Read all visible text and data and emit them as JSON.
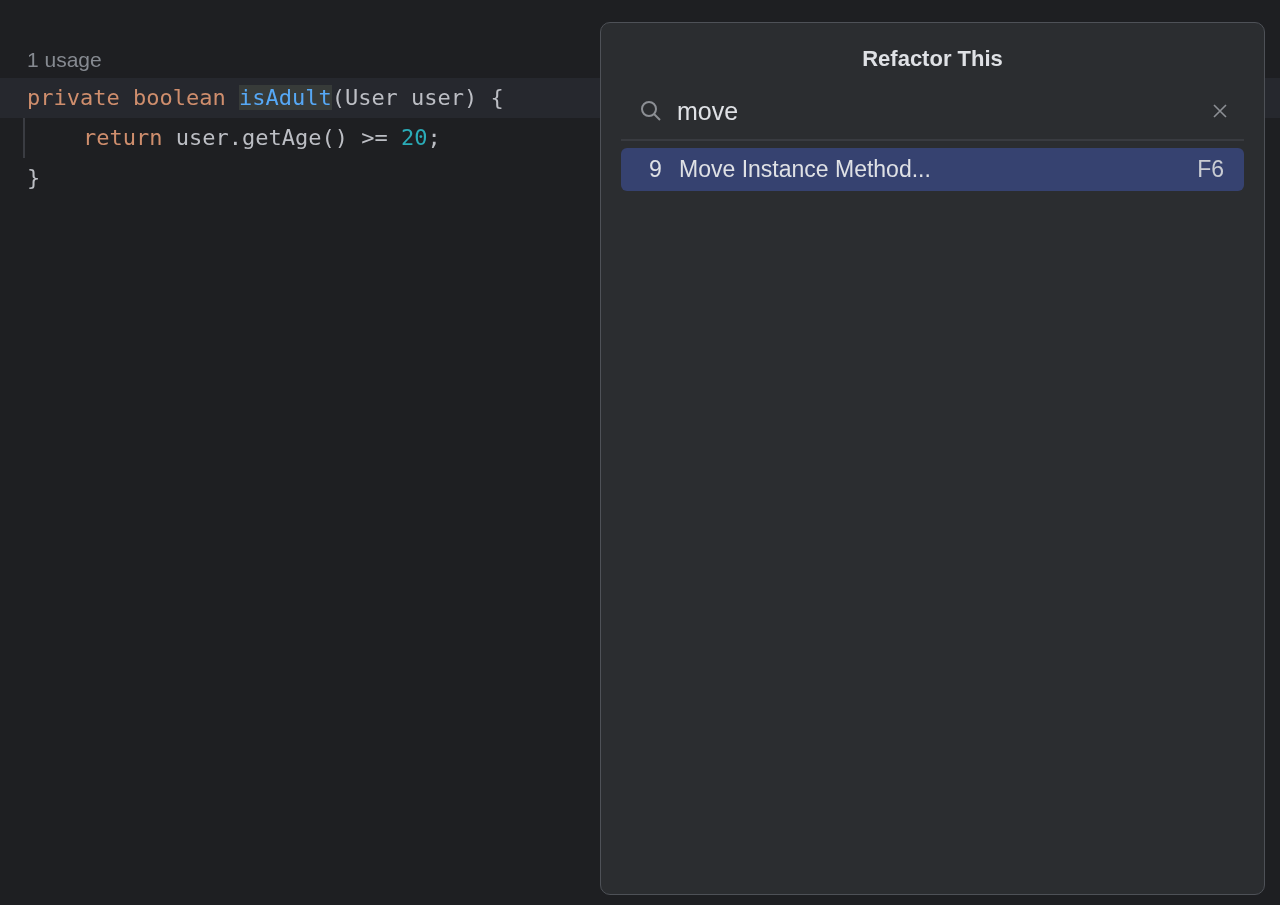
{
  "editor": {
    "inlay_hint": "1 usage",
    "lines": [
      {
        "current": true,
        "tokens": [
          {
            "kind": "keyword",
            "text": "private boolean ",
            "highlighted": false
          },
          {
            "kind": "method",
            "text": "isAdult",
            "highlighted": true
          },
          {
            "kind": "plain",
            "text": "(User user) {",
            "highlighted": false
          }
        ],
        "children": [
          {
            "current": false,
            "tokens": [
              {
                "kind": "keyword",
                "text": "return ",
                "highlighted": false
              },
              {
                "kind": "plain",
                "text": "user.getAge() >= ",
                "highlighted": false
              },
              {
                "kind": "number",
                "text": "20",
                "highlighted": false
              },
              {
                "kind": "plain",
                "text": ";",
                "highlighted": false
              }
            ]
          }
        ]
      },
      {
        "current": false,
        "tokens": [
          {
            "kind": "plain",
            "text": "}",
            "highlighted": false
          }
        ]
      }
    ]
  },
  "popup": {
    "title": "Refactor This",
    "search": {
      "value": "move"
    },
    "items": [
      {
        "number": "9",
        "label": "Move Instance Method...",
        "shortcut": "F6",
        "selected": true
      }
    ]
  }
}
